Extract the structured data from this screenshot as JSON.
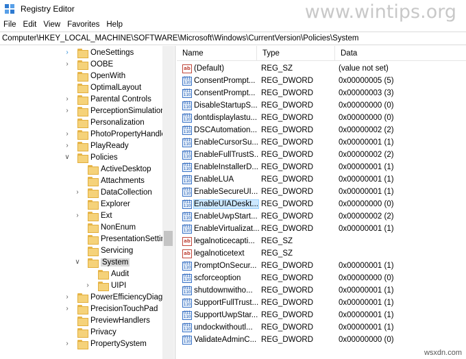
{
  "window": {
    "title": "Registry Editor",
    "watermark": "www.wintips.org"
  },
  "menu": [
    "File",
    "Edit",
    "View",
    "Favorites",
    "Help"
  ],
  "address": "Computer\\HKEY_LOCAL_MACHINE\\SOFTWARE\\Microsoft\\Windows\\CurrentVersion\\Policies\\System",
  "tree": [
    {
      "label": "OneSettings",
      "indent": 0,
      "chevron": ">",
      "chev_highlight": true,
      "selected": false
    },
    {
      "label": "OOBE",
      "indent": 0,
      "chevron": ">",
      "chev_highlight": false,
      "selected": false
    },
    {
      "label": "OpenWith",
      "indent": 0,
      "chevron": "",
      "chev_highlight": false,
      "selected": false
    },
    {
      "label": "OptimalLayout",
      "indent": 0,
      "chevron": "",
      "chev_highlight": false,
      "selected": false
    },
    {
      "label": "Parental Controls",
      "indent": 0,
      "chevron": ">",
      "chev_highlight": false,
      "selected": false
    },
    {
      "label": "PerceptionSimulationI",
      "indent": 0,
      "chevron": ">",
      "chev_highlight": false,
      "selected": false
    },
    {
      "label": "Personalization",
      "indent": 0,
      "chevron": "",
      "chev_highlight": false,
      "selected": false
    },
    {
      "label": "PhotoPropertyHandle",
      "indent": 0,
      "chevron": ">",
      "chev_highlight": false,
      "selected": false
    },
    {
      "label": "PlayReady",
      "indent": 0,
      "chevron": ">",
      "chev_highlight": false,
      "selected": false
    },
    {
      "label": "Policies",
      "indent": 0,
      "chevron": "v",
      "chev_highlight": false,
      "selected": false
    },
    {
      "label": "ActiveDesktop",
      "indent": 1,
      "chevron": "",
      "chev_highlight": false,
      "selected": false
    },
    {
      "label": "Attachments",
      "indent": 1,
      "chevron": "",
      "chev_highlight": false,
      "selected": false
    },
    {
      "label": "DataCollection",
      "indent": 1,
      "chevron": ">",
      "chev_highlight": false,
      "selected": false
    },
    {
      "label": "Explorer",
      "indent": 1,
      "chevron": "",
      "chev_highlight": false,
      "selected": false
    },
    {
      "label": "Ext",
      "indent": 1,
      "chevron": ">",
      "chev_highlight": false,
      "selected": false
    },
    {
      "label": "NonEnum",
      "indent": 1,
      "chevron": "",
      "chev_highlight": false,
      "selected": false
    },
    {
      "label": "PresentationSetting",
      "indent": 1,
      "chevron": "",
      "chev_highlight": false,
      "selected": false
    },
    {
      "label": "Servicing",
      "indent": 1,
      "chevron": "",
      "chev_highlight": false,
      "selected": false
    },
    {
      "label": "System",
      "indent": 1,
      "chevron": "v",
      "chev_highlight": false,
      "selected": true
    },
    {
      "label": "Audit",
      "indent": 2,
      "chevron": "",
      "chev_highlight": false,
      "selected": false
    },
    {
      "label": "UIPI",
      "indent": 2,
      "chevron": ">",
      "chev_highlight": false,
      "selected": false
    },
    {
      "label": "PowerEfficiencyDiagn",
      "indent": 0,
      "chevron": ">",
      "chev_highlight": false,
      "selected": false
    },
    {
      "label": "PrecisionTouchPad",
      "indent": 0,
      "chevron": ">",
      "chev_highlight": false,
      "selected": false
    },
    {
      "label": "PreviewHandlers",
      "indent": 0,
      "chevron": "",
      "chev_highlight": false,
      "selected": false
    },
    {
      "label": "Privacy",
      "indent": 0,
      "chevron": "",
      "chev_highlight": false,
      "selected": false
    },
    {
      "label": "PropertySystem",
      "indent": 0,
      "chevron": ">",
      "chev_highlight": false,
      "selected": false
    }
  ],
  "columns": {
    "name": "Name",
    "type": "Type",
    "data": "Data"
  },
  "values": [
    {
      "icon": "string-value-icon",
      "name": "(Default)",
      "type": "REG_SZ",
      "data": "(value not set)",
      "selected": false
    },
    {
      "icon": "binary-value-icon",
      "name": "ConsentPrompt...",
      "type": "REG_DWORD",
      "data": "0x00000005 (5)",
      "selected": false
    },
    {
      "icon": "binary-value-icon",
      "name": "ConsentPrompt...",
      "type": "REG_DWORD",
      "data": "0x00000003 (3)",
      "selected": false
    },
    {
      "icon": "binary-value-icon",
      "name": "DisableStartupS...",
      "type": "REG_DWORD",
      "data": "0x00000000 (0)",
      "selected": false
    },
    {
      "icon": "binary-value-icon",
      "name": "dontdisplaylastu...",
      "type": "REG_DWORD",
      "data": "0x00000000 (0)",
      "selected": false
    },
    {
      "icon": "binary-value-icon",
      "name": "DSCAutomation...",
      "type": "REG_DWORD",
      "data": "0x00000002 (2)",
      "selected": false
    },
    {
      "icon": "binary-value-icon",
      "name": "EnableCursorSu...",
      "type": "REG_DWORD",
      "data": "0x00000001 (1)",
      "selected": false
    },
    {
      "icon": "binary-value-icon",
      "name": "EnableFullTrustS...",
      "type": "REG_DWORD",
      "data": "0x00000002 (2)",
      "selected": false
    },
    {
      "icon": "binary-value-icon",
      "name": "EnableInstallerD...",
      "type": "REG_DWORD",
      "data": "0x00000001 (1)",
      "selected": false
    },
    {
      "icon": "binary-value-icon",
      "name": "EnableLUA",
      "type": "REG_DWORD",
      "data": "0x00000001 (1)",
      "selected": false
    },
    {
      "icon": "binary-value-icon",
      "name": "EnableSecureUI...",
      "type": "REG_DWORD",
      "data": "0x00000001 (1)",
      "selected": false
    },
    {
      "icon": "binary-value-icon",
      "name": "EnableUIADeskt...",
      "type": "REG_DWORD",
      "data": "0x00000000 (0)",
      "selected": true
    },
    {
      "icon": "binary-value-icon",
      "name": "EnableUwpStart...",
      "type": "REG_DWORD",
      "data": "0x00000002 (2)",
      "selected": false
    },
    {
      "icon": "binary-value-icon",
      "name": "EnableVirtualizat...",
      "type": "REG_DWORD",
      "data": "0x00000001 (1)",
      "selected": false
    },
    {
      "icon": "string-value-icon",
      "name": "legalnoticecapti...",
      "type": "REG_SZ",
      "data": "",
      "selected": false
    },
    {
      "icon": "string-value-icon",
      "name": "legalnoticetext",
      "type": "REG_SZ",
      "data": "",
      "selected": false
    },
    {
      "icon": "binary-value-icon",
      "name": "PromptOnSecur...",
      "type": "REG_DWORD",
      "data": "0x00000001 (1)",
      "selected": false
    },
    {
      "icon": "binary-value-icon",
      "name": "scforceoption",
      "type": "REG_DWORD",
      "data": "0x00000000 (0)",
      "selected": false
    },
    {
      "icon": "binary-value-icon",
      "name": "shutdownwitho...",
      "type": "REG_DWORD",
      "data": "0x00000001 (1)",
      "selected": false
    },
    {
      "icon": "binary-value-icon",
      "name": "SupportFullTrust...",
      "type": "REG_DWORD",
      "data": "0x00000001 (1)",
      "selected": false
    },
    {
      "icon": "binary-value-icon",
      "name": "SupportUwpStar...",
      "type": "REG_DWORD",
      "data": "0x00000001 (1)",
      "selected": false
    },
    {
      "icon": "binary-value-icon",
      "name": "undockwithoutl...",
      "type": "REG_DWORD",
      "data": "0x00000001 (1)",
      "selected": false
    },
    {
      "icon": "binary-value-icon",
      "name": "ValidateAdminC...",
      "type": "REG_DWORD",
      "data": "0x00000000 (0)",
      "selected": false
    }
  ],
  "icon_glyphs": {
    "string": "ab",
    "binary": "011\n110"
  },
  "footer_brand": "wsxdn.com",
  "colors": {
    "selection": "#cce8ff",
    "tree_selection": "#d9d9d9",
    "folder": "#f5d27a",
    "watermark": "#c8c8c8"
  }
}
